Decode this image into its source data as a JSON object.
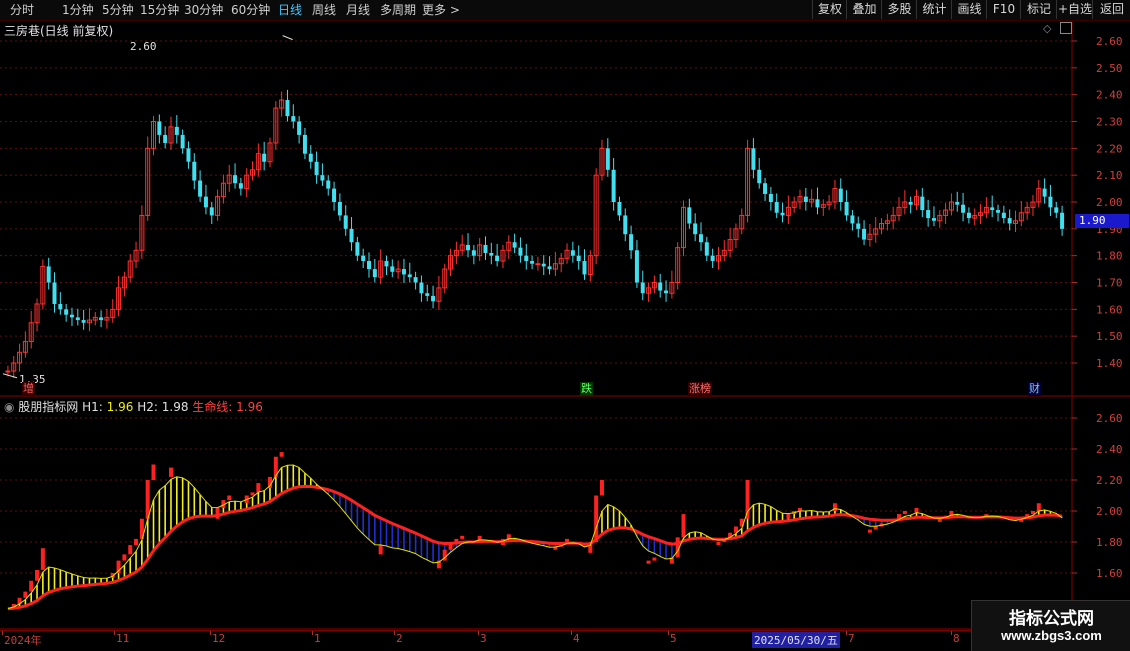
{
  "toolbar": {
    "periods": [
      {
        "label": "分时",
        "active": false
      },
      {
        "label": "1分钟",
        "active": false
      },
      {
        "label": "5分钟",
        "active": false
      },
      {
        "label": "15分钟",
        "active": false
      },
      {
        "label": "30分钟",
        "active": false
      },
      {
        "label": "60分钟",
        "active": false
      },
      {
        "label": "日线",
        "active": true
      },
      {
        "label": "周线",
        "active": false
      },
      {
        "label": "月线",
        "active": false
      },
      {
        "label": "多周期",
        "active": false
      },
      {
        "label": "更多 >",
        "active": false
      }
    ],
    "buttons": [
      "复权",
      "叠加",
      "多股",
      "统计",
      "画线",
      "F10",
      "标记",
      "+自选",
      "返回"
    ]
  },
  "main_panel": {
    "title": "三房巷(日线 前复权)",
    "high_label": "2.60",
    "low_label": "1.35",
    "last_price": "1.90",
    "markers": [
      {
        "text": "增",
        "color": "#ff6060",
        "bg": "#300"
      },
      {
        "text": "跌",
        "color": "#60ff60",
        "bg": "#030"
      },
      {
        "text": "涨榜",
        "color": "#ff7070",
        "bg": "#300"
      },
      {
        "text": "财",
        "color": "#80c0ff",
        "bg": "#003"
      }
    ]
  },
  "indicator_panel": {
    "name": "股朋指标网",
    "h1_label": "H1:",
    "h1_value": "1.96",
    "h2_label": "H2:",
    "h2_value": "1.98",
    "life_label": "生命线:",
    "life_value": "1.96"
  },
  "date_axis": {
    "labels": [
      "2024年",
      "11",
      "12",
      "1",
      "2",
      "3",
      "4",
      "5",
      "7",
      "8"
    ],
    "cursor": "2025/05/30/五"
  },
  "watermark": {
    "title": "指标公式网",
    "url": "www.zbgs3.com"
  },
  "chart_data": {
    "type": "candlestick",
    "main_y_ticks": [
      "2.60",
      "2.50",
      "2.40",
      "2.30",
      "2.20",
      "2.10",
      "2.00",
      "1.90",
      "1.80",
      "1.70",
      "1.60",
      "1.50",
      "1.40"
    ],
    "ind_y_ticks": [
      "2.60",
      "2.40",
      "2.20",
      "2.00",
      "1.80",
      "1.60"
    ],
    "ylim": [
      1.35,
      2.65
    ],
    "closes": [
      1.37,
      1.4,
      1.44,
      1.48,
      1.55,
      1.62,
      1.76,
      1.7,
      1.62,
      1.6,
      1.58,
      1.57,
      1.56,
      1.55,
      1.56,
      1.57,
      1.56,
      1.57,
      1.6,
      1.68,
      1.72,
      1.78,
      1.82,
      1.95,
      2.2,
      2.3,
      2.25,
      2.22,
      2.28,
      2.25,
      2.2,
      2.15,
      2.08,
      2.02,
      1.98,
      1.95,
      2.02,
      2.07,
      2.1,
      2.07,
      2.05,
      2.1,
      2.12,
      2.18,
      2.15,
      2.22,
      2.35,
      2.38,
      2.32,
      2.3,
      2.25,
      2.18,
      2.15,
      2.1,
      2.08,
      2.05,
      2.0,
      1.95,
      1.9,
      1.85,
      1.8,
      1.78,
      1.75,
      1.72,
      1.78,
      1.76,
      1.74,
      1.75,
      1.73,
      1.72,
      1.7,
      1.66,
      1.65,
      1.63,
      1.68,
      1.75,
      1.8,
      1.82,
      1.84,
      1.82,
      1.8,
      1.84,
      1.81,
      1.8,
      1.78,
      1.82,
      1.85,
      1.83,
      1.8,
      1.78,
      1.77,
      1.77,
      1.76,
      1.75,
      1.77,
      1.79,
      1.82,
      1.8,
      1.78,
      1.73,
      1.8,
      2.1,
      2.2,
      2.12,
      2.0,
      1.95,
      1.88,
      1.82,
      1.7,
      1.66,
      1.68,
      1.7,
      1.67,
      1.66,
      1.7,
      1.83,
      1.98,
      1.92,
      1.88,
      1.85,
      1.8,
      1.78,
      1.8,
      1.82,
      1.86,
      1.9,
      1.95,
      2.2,
      2.12,
      2.07,
      2.03,
      2.0,
      1.96,
      1.95,
      1.98,
      2.0,
      2.02,
      2.0,
      2.01,
      1.98,
      1.99,
      2.0,
      2.05,
      2.0,
      1.95,
      1.92,
      1.9,
      1.86,
      1.88,
      1.9,
      1.92,
      1.93,
      1.95,
      1.98,
      2.0,
      1.99,
      2.02,
      1.97,
      1.94,
      1.93,
      1.95,
      1.97,
      2.0,
      1.99,
      1.96,
      1.94,
      1.95,
      1.96,
      1.98,
      1.97,
      1.96,
      1.94,
      1.92,
      1.93,
      1.96,
      1.98,
      2.0,
      2.05,
      2.02,
      1.98,
      1.96,
      1.9
    ]
  }
}
